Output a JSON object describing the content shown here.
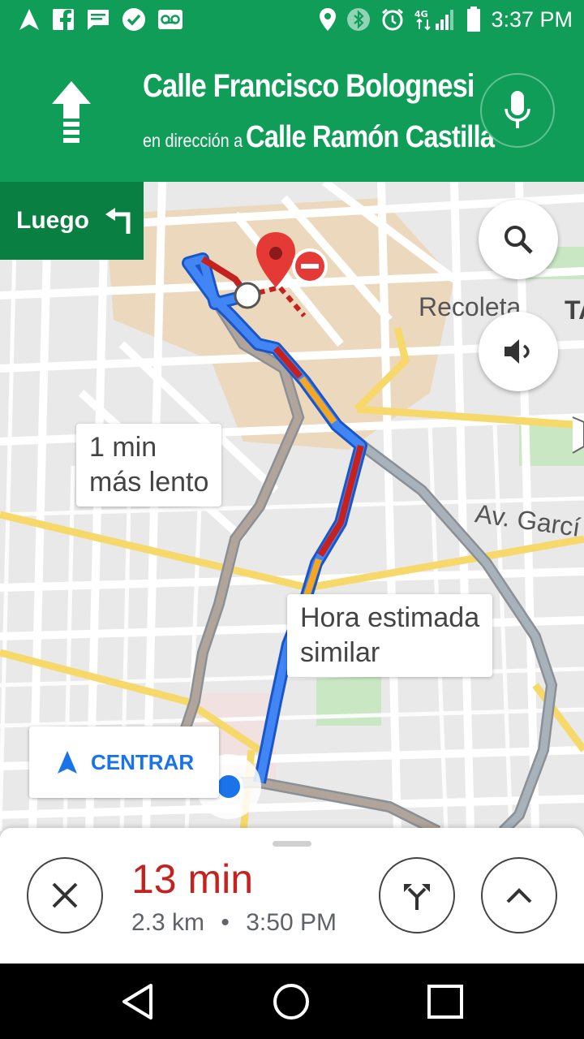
{
  "status_bar": {
    "time": "3:37 PM",
    "icons": [
      "navigation-icon",
      "facebook-icon",
      "message-icon",
      "check-circle-icon",
      "voicemail-icon",
      "location-pin-icon",
      "bluetooth-icon",
      "alarm-icon",
      "4g-signal-icon",
      "battery-icon"
    ]
  },
  "navigation": {
    "street": "Calle Francisco Bolognesi",
    "towards_prefix": "en dirección a",
    "towards_street": "Calle Ramón Castilla",
    "maneuver_icon": "straight-arrow-icon"
  },
  "then_card": {
    "label": "Luego",
    "icon": "turn-left-icon"
  },
  "map": {
    "bubble_slower": {
      "line1": "1 min",
      "line2": "más lento"
    },
    "bubble_similar": {
      "line1": "Hora estimada",
      "line2": "similar"
    },
    "labels": {
      "recoleta": "Recoleta",
      "garcia": "Av. Garcí",
      "ta": "TA"
    }
  },
  "centrar_label": "CENTRAR",
  "trip": {
    "duration": "13 min",
    "distance": "2.3 km",
    "separator": "•",
    "arrival": "3:50 PM"
  },
  "colors": {
    "green": "#0f9d58",
    "dark_green": "#0a7f42",
    "route_blue": "#4285f4",
    "traffic_red": "#c5221f",
    "traffic_orange": "#f5a623",
    "alt_gray": "#a0a7ae"
  }
}
